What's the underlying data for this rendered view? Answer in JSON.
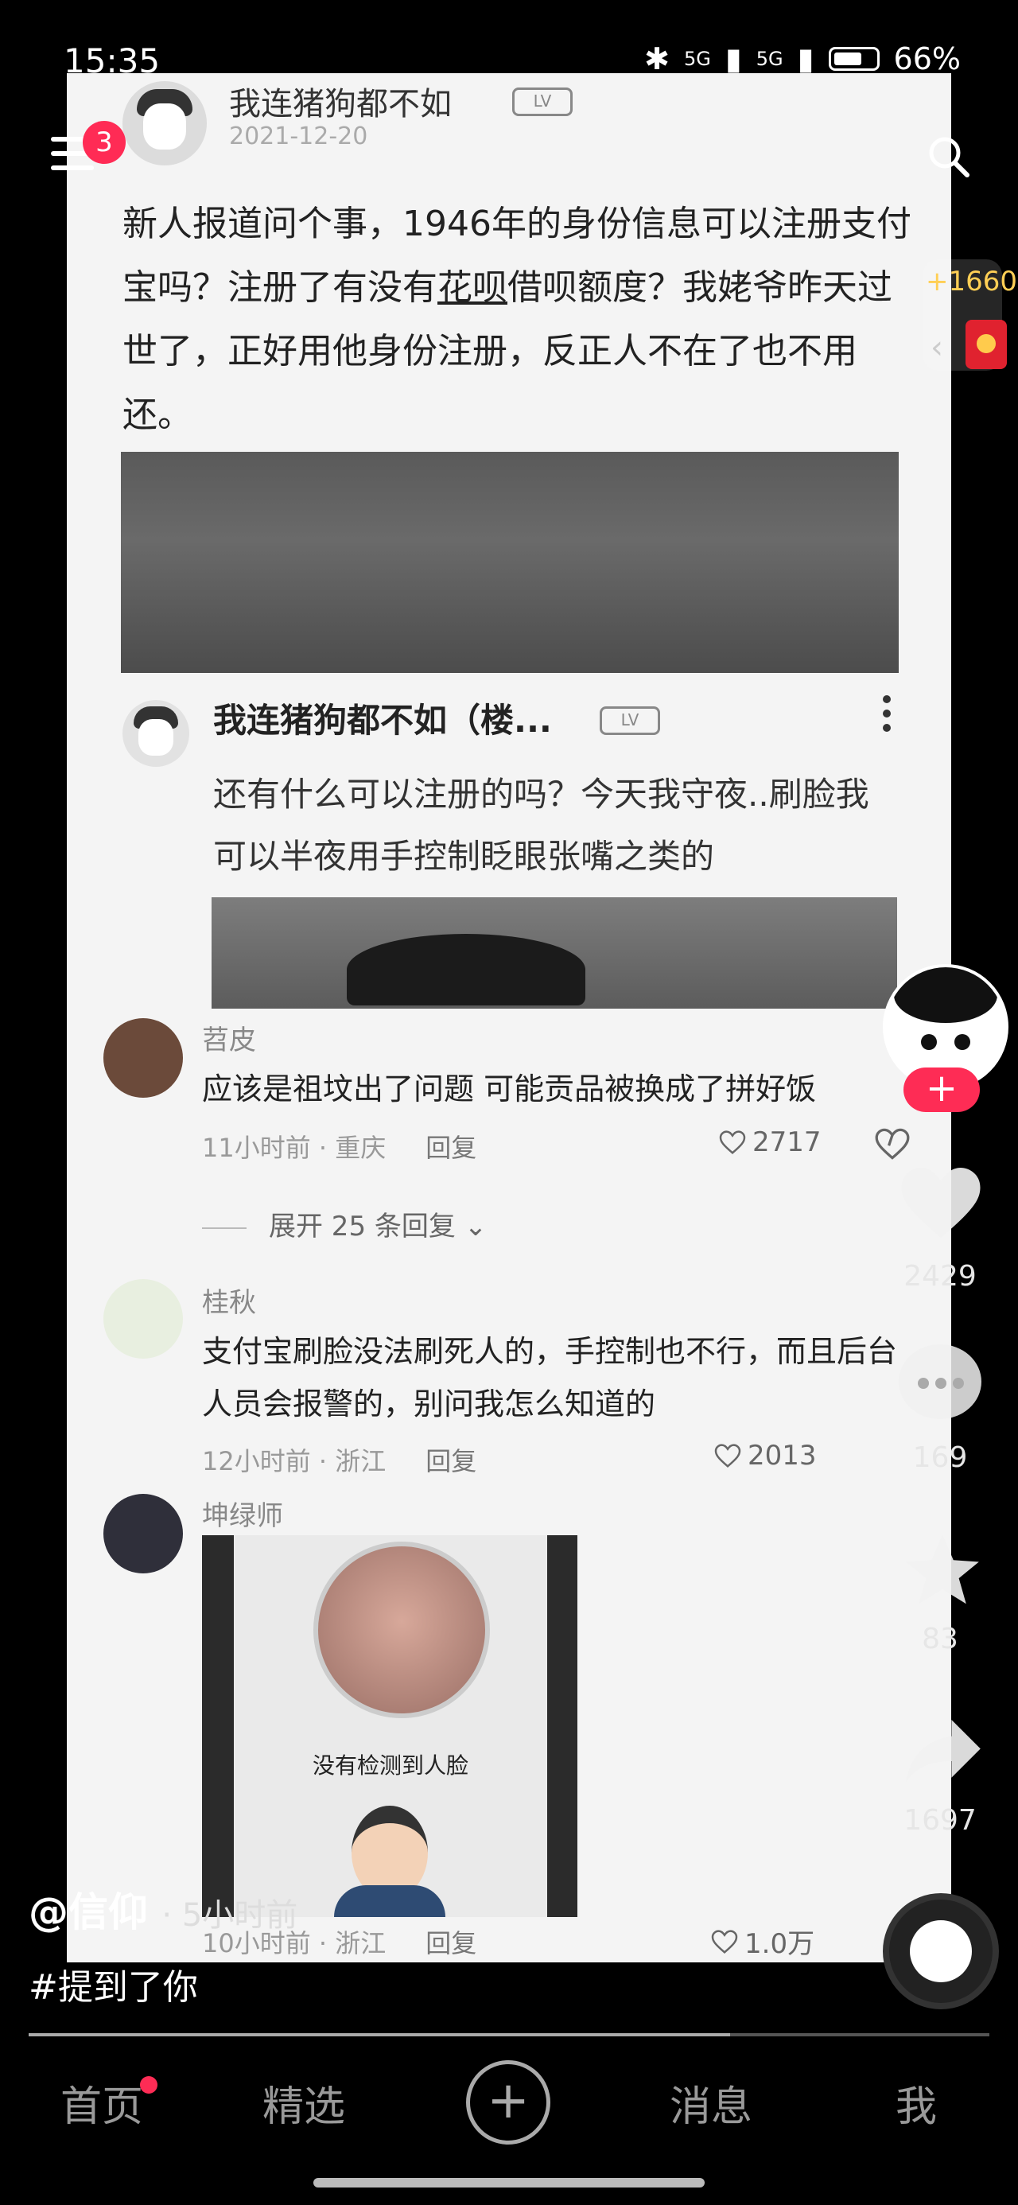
{
  "status_bar": {
    "time": "15:35",
    "network1": "5G",
    "network2": "5G",
    "battery": "66%"
  },
  "top": {
    "notification_count": "3"
  },
  "post": {
    "username": "我连猪狗都不如",
    "tag": "LV",
    "date": "2021-12-20",
    "body_before": "新人报道问个事，1946年的身份信息可以注册支付宝吗？注册了有没有",
    "body_link": "花呗",
    "body_after": "借呗额度？我姥爷昨天过世了，正好用他身份注册，反正人不在了也不用还。"
  },
  "reply": {
    "username": "我连猪狗都不如（楼...",
    "tag": "LV",
    "body": "还有什么可以注册的吗？今天我守夜..刷脸我可以半夜用手控制眨眼张嘴之类的"
  },
  "comments": [
    {
      "name": "苕皮",
      "text": "应该是祖坟出了问题 可能贡品被换成了拼好饭",
      "meta": "11小时前 · 重庆",
      "reply": "回复",
      "likes": "2717",
      "avatar_color": "#6b4a3a"
    },
    {
      "name": "桂秋",
      "text": "支付宝刷脸没法刷死人的，手控制也不行，而且后台人员会报警的，别问我怎么知道的",
      "meta": "12小时前 · 浙江",
      "reply": "回复",
      "likes": "2013",
      "avatar_color": "#9fbf8a"
    },
    {
      "name": "坤绿师",
      "text": "",
      "meta": "10小时前 · 浙江",
      "reply": "回复",
      "likes": "1.0万",
      "avatar_color": "#2f2f3a"
    }
  ],
  "expand_replies": "展开 25 条回复",
  "photo_caption": "没有检测到人脸",
  "rail": {
    "redpack_count": "+1660",
    "likes": "2429",
    "comments": "169",
    "favorites": "83",
    "shares": "1697"
  },
  "author": {
    "handle": "@信仰",
    "time": "· 5小时前"
  },
  "caption": "#提到了你",
  "progress": 0.73,
  "nav": {
    "home": "首页",
    "featured": "精选",
    "plus": "+",
    "messages": "消息",
    "me": "我"
  },
  "colors": {
    "accent": "#fe2c55",
    "redpack": "#ffcf55"
  }
}
